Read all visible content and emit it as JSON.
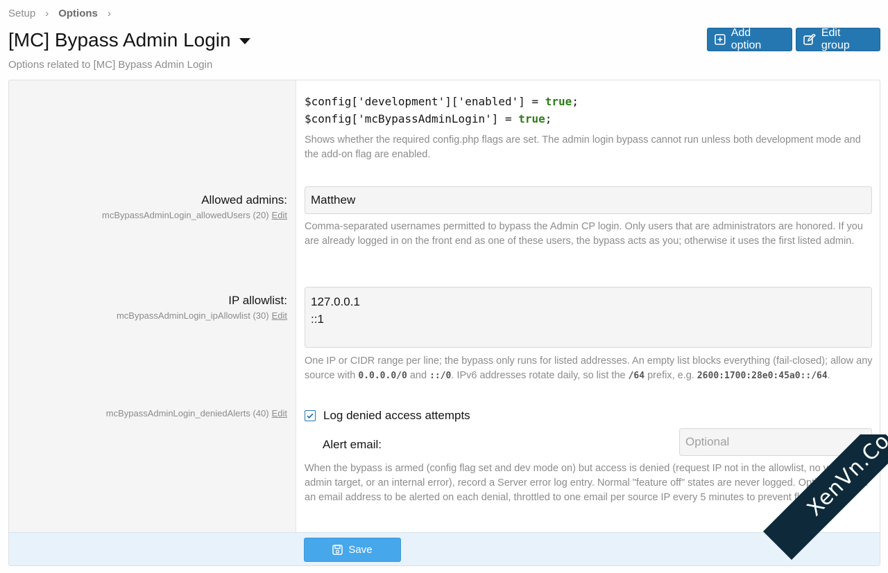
{
  "breadcrumb": {
    "items": [
      "Setup",
      "Options"
    ]
  },
  "page": {
    "title": "[MC] Bypass Admin Login",
    "subtitle": "Options related to [MC] Bypass Admin Login"
  },
  "toolbar": {
    "add_label": "Add option",
    "edit_label": "Edit group"
  },
  "config_block": {
    "line1_prefix": "$config['development']['enabled'] = ",
    "line1_value": "true",
    "line2_prefix": "$config['mcBypassAdminLogin'] = ",
    "line2_value": "true",
    "suffix": ";",
    "explain": "Shows whether the required config.php flags are set. The admin login bypass cannot run unless both development mode and the add-on flag are enabled."
  },
  "options": {
    "allowed_admins": {
      "label": "Allowed admins:",
      "hint": "mcBypassAdminLogin_allowedUsers (20)",
      "edit": "Edit",
      "value": "Matthew",
      "explain": "Comma-separated usernames permitted to bypass the Admin CP login. Only users that are administrators are honored. If you are already logged in on the front end as one of these users, the bypass acts as you; otherwise it uses the first listed admin."
    },
    "ip_allowlist": {
      "label": "IP allowlist:",
      "hint": "mcBypassAdminLogin_ipAllowlist (30)",
      "edit": "Edit",
      "value": "127.0.0.1\n::1",
      "explain_1": "One IP or CIDR range per line; the bypass only runs for listed addresses. An empty list blocks everything (fail-closed); allow any source with ",
      "code_1": "0.0.0.0/0",
      "explain_2": " and ",
      "code_2": "::/0",
      "explain_3": ". IPv6 addresses rotate daily, so list the ",
      "code_3": "/64",
      "explain_4": " prefix, e.g. ",
      "code_4": "2600:1700:28e0:45a0::/64",
      "explain_5": "."
    },
    "denied_alerts": {
      "hint": "mcBypassAdminLogin_deniedAlerts (40)",
      "edit": "Edit",
      "checkbox_label": "Log denied access attempts",
      "checked": true,
      "email_label": "Alert email:",
      "email_placeholder": "Optional",
      "explain": "When the bypass is armed (config flag set and dev mode on) but access is denied (request IP not in the allowlist, no valid admin target, or an internal error), record a Server error log entry. Normal \"feature off\" states are never logged. Optionally enter an email address to be alerted on each denial, throttled to one email per source IP every 5 minutes to prevent flooding."
    }
  },
  "footer": {
    "save_label": "Save"
  },
  "watermark": {
    "text": "XenVn.Com"
  },
  "colors": {
    "accent": "#2577b1",
    "save": "#47a7eb",
    "code_keyword": "#2f7d18"
  }
}
